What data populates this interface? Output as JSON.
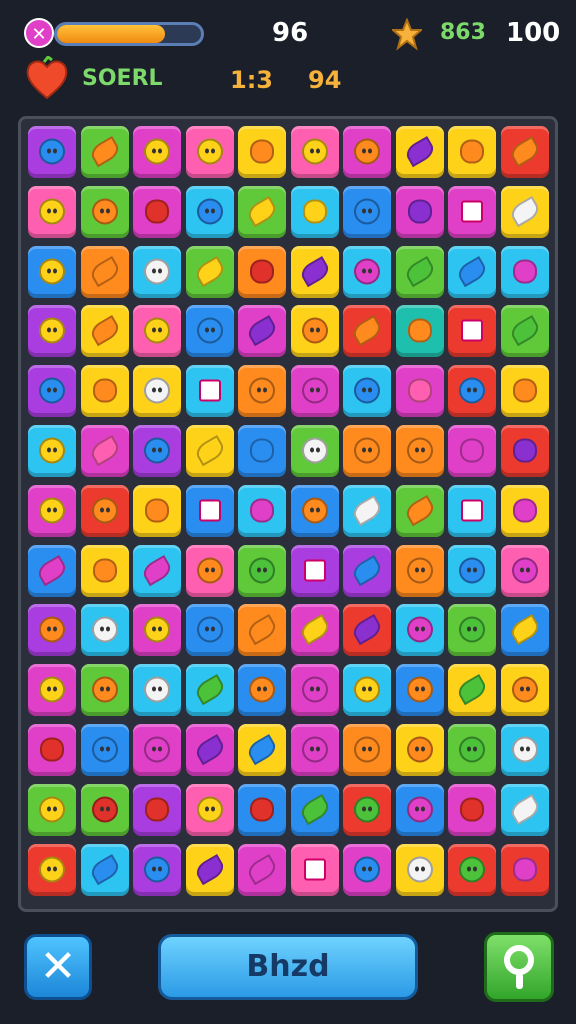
{
  "hud": {
    "close_glyph": "✕",
    "progress": 0.75,
    "score": "96",
    "coins": "863",
    "total": "100",
    "label": "SOERL",
    "timer": "1:3",
    "moves": "94"
  },
  "actions": {
    "close_glyph": "✕",
    "main_label": "Bhzd",
    "hint_icon": "lightbulb-icon"
  },
  "colors": {
    "purple": "#a93de0",
    "green": "#5fc93a",
    "magenta": "#e040c8",
    "pink": "#ff5fb0",
    "yellow": "#ffd21a",
    "red": "#ec3a2e",
    "blue": "#2a8df0",
    "cyan": "#2ec4f2",
    "orange": "#ff8a1e",
    "teal": "#1fbfae"
  },
  "board": {
    "rows": [
      [
        "purple:face-blue",
        "green:leaf-orange",
        "magenta:face-yellow",
        "pink:face-yellow",
        "yellow:gem-orange",
        "pink:face-yellow",
        "magenta:face-orange",
        "yellow:leaf-purple",
        "yellow:gem-orange",
        "red:leaf-orange"
      ],
      [
        "pink:face-yellow",
        "green:face-orange",
        "magenta:gem-red",
        "cyan:face-blue",
        "green:leaf-yellow",
        "cyan:gem-yellow",
        "blue:face-blue",
        "magenta:gem-purple",
        "magenta:cube",
        "yellow:leaf-white"
      ],
      [
        "blue:face-yellow",
        "orange:leaf-orange",
        "cyan:face-white",
        "green:leaf-yellow",
        "orange:gem-red",
        "yellow:leaf-purple",
        "cyan:face-magenta",
        "green:leaf-green",
        "cyan:leaf-blue",
        "cyan:gem-magenta"
      ],
      [
        "purple:face-yellow",
        "yellow:leaf-orange",
        "pink:face-yellow",
        "blue:face-blue",
        "magenta:leaf-purple",
        "yellow:face-orange",
        "red:leaf-orange",
        "teal:gem-orange",
        "red:cube",
        "green:leaf-green"
      ],
      [
        "purple:face-blue",
        "yellow:gem-orange",
        "yellow:face-white",
        "cyan:cube",
        "orange:face-orange",
        "magenta:face-magenta",
        "cyan:face-blue",
        "magenta:gem-pink",
        "red:face-blue",
        "yellow:gem-orange"
      ],
      [
        "cyan:face-yellow",
        "magenta:leaf-pink",
        "purple:face-blue",
        "yellow:leaf-yellow",
        "blue:gem-blue",
        "green:face-white",
        "orange:face-orange",
        "orange:face-orange",
        "magenta:gem-magenta",
        "red:gem-purple"
      ],
      [
        "magenta:face-yellow",
        "red:face-orange",
        "yellow:gem-orange",
        "blue:cube",
        "cyan:gem-magenta",
        "blue:face-orange",
        "cyan:leaf-white",
        "green:leaf-orange",
        "cyan:cube",
        "yellow:gem-magenta"
      ],
      [
        "blue:leaf-magenta",
        "yellow:gem-orange",
        "cyan:leaf-magenta",
        "pink:face-orange",
        "green:face-green",
        "purple:cube",
        "purple:leaf-blue",
        "orange:face-orange",
        "cyan:face-blue",
        "pink:face-magenta"
      ],
      [
        "purple:face-orange",
        "cyan:face-white",
        "magenta:face-yellow",
        "blue:face-blue",
        "orange:leaf-orange",
        "magenta:leaf-yellow",
        "red:leaf-purple",
        "cyan:face-magenta",
        "green:face-green",
        "blue:leaf-yellow"
      ],
      [
        "magenta:face-yellow",
        "green:face-orange",
        "cyan:face-white",
        "cyan:leaf-green",
        "blue:face-orange",
        "magenta:face-magenta",
        "cyan:face-yellow",
        "blue:face-orange",
        "yellow:leaf-green",
        "yellow:face-orange"
      ],
      [
        "magenta:gem-red",
        "blue:face-blue",
        "magenta:face-magenta",
        "magenta:leaf-purple",
        "yellow:leaf-blue",
        "magenta:face-magenta",
        "orange:face-orange",
        "yellow:face-orange",
        "green:face-green",
        "cyan:face-white"
      ],
      [
        "green:face-yellow",
        "green:face-red",
        "purple:gem-red",
        "pink:face-yellow",
        "blue:gem-red",
        "blue:leaf-green",
        "red:face-green",
        "blue:face-magenta",
        "magenta:gem-red",
        "cyan:leaf-white"
      ],
      [
        "red:face-yellow",
        "cyan:leaf-blue",
        "purple:face-blue",
        "yellow:leaf-purple",
        "magenta:leaf-magenta",
        "pink:cube",
        "magenta:face-blue",
        "yellow:face-white",
        "red:face-green",
        "red:gem-magenta"
      ]
    ]
  }
}
